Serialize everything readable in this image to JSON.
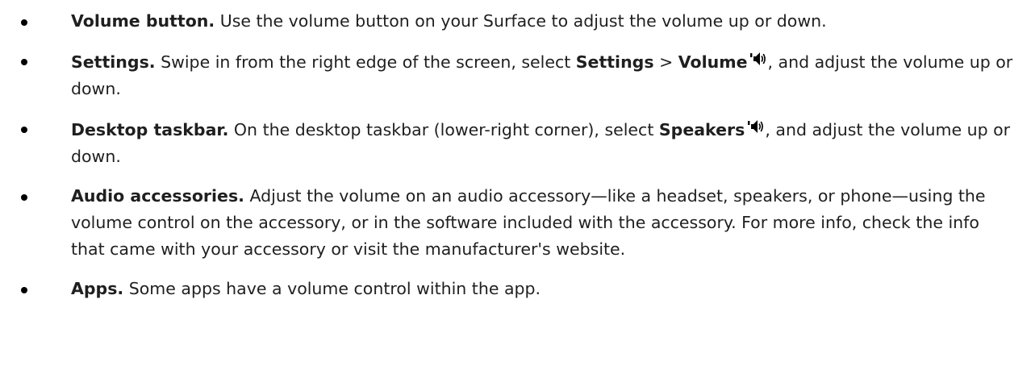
{
  "items": [
    {
      "term": "Volume button.",
      "text": " Use the volume button on your Surface to adjust the volume up or down."
    },
    {
      "term": "Settings.",
      "text_a": " Swipe in from the right edge of the screen, select ",
      "ui_a": "Settings",
      "sep": " > ",
      "ui_b": "Volume",
      "icon": "speaker-volume-icon",
      "text_b": ", and adjust the volume up or down."
    },
    {
      "term": "Desktop taskbar.",
      "text_a": " On the desktop taskbar (lower-right corner), select ",
      "ui_a": "Speakers",
      "icon": "speaker-volume-icon",
      "text_b": ", and adjust the volume up or down."
    },
    {
      "term": "Audio accessories.",
      "text": " Adjust the volume on an audio accessory—like a headset, speakers, or phone—using the volume control on the accessory, or in the software included with the accessory. For more info, check the info that came with your accessory or visit the manufacturer's website."
    },
    {
      "term": "Apps.",
      "text": " Some apps have a volume control within the app."
    }
  ]
}
